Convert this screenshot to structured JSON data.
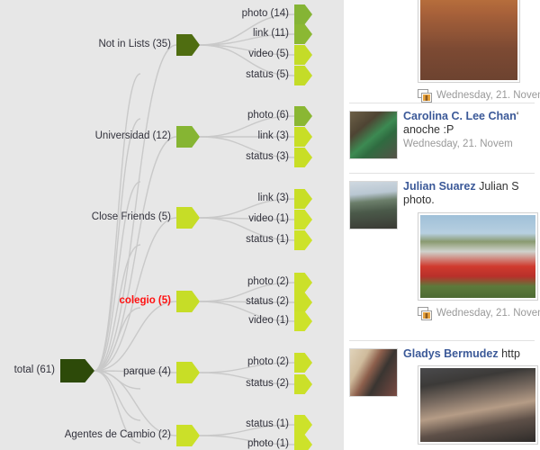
{
  "viz": {
    "background": "#e7e7e7",
    "link_color": "#c9c9c9",
    "root": {
      "label": "total (61)",
      "value": 61,
      "color": "#2d4a09"
    },
    "branches": [
      {
        "label": "Not in Lists (35)",
        "value": 35,
        "color": "#4f6d11",
        "children": [
          {
            "label": "photo (14)",
            "value": 14,
            "color": "#85b435"
          },
          {
            "label": "link (11)",
            "value": 11,
            "color": "#8bb833"
          },
          {
            "label": "video (5)",
            "value": 5,
            "color": "#c4dc28"
          },
          {
            "label": "status (5)",
            "value": 5,
            "color": "#c4dc28"
          }
        ]
      },
      {
        "label": "Universidad (12)",
        "value": 12,
        "color": "#86b533",
        "children": [
          {
            "label": "photo (6)",
            "value": 6,
            "color": "#8ab733"
          },
          {
            "label": "link (3)",
            "value": 3,
            "color": "#c8de26"
          },
          {
            "label": "status (3)",
            "value": 3,
            "color": "#c8de26"
          }
        ]
      },
      {
        "label": "Close Friends (5)",
        "value": 5,
        "color": "#c6dd27",
        "children": [
          {
            "label": "link (3)",
            "value": 3,
            "color": "#c8de26"
          },
          {
            "label": "video (1)",
            "value": 1,
            "color": "#cde22a"
          },
          {
            "label": "status (1)",
            "value": 1,
            "color": "#cde22a"
          }
        ]
      },
      {
        "label": "colegio (5)",
        "value": 5,
        "color": "#c6dd27",
        "highlight": true,
        "children": [
          {
            "label": "photo (2)",
            "value": 2,
            "color": "#cbe029"
          },
          {
            "label": "status (2)",
            "value": 2,
            "color": "#cbe029"
          },
          {
            "label": "video (1)",
            "value": 1,
            "color": "#cde22a"
          }
        ]
      },
      {
        "label": "parque (4)",
        "value": 4,
        "color": "#c8de26",
        "children": [
          {
            "label": "photo (2)",
            "value": 2,
            "color": "#cbe029"
          },
          {
            "label": "status (2)",
            "value": 2,
            "color": "#cbe029"
          }
        ]
      },
      {
        "label": "Agentes de Cambio (2)",
        "value": 2,
        "color": "#cbe029",
        "children": [
          {
            "label": "status (1)",
            "value": 1,
            "color": "#cde22a"
          },
          {
            "label": "photo (1)",
            "value": 1,
            "color": "#cde22a"
          }
        ]
      }
    ]
  },
  "feed": {
    "stories": [
      {
        "id": "story-top",
        "has_avatar": false,
        "big_photo": true,
        "photo_alt": "two-women-photo",
        "timestamp": "Wednesday, 21. Novem",
        "timestamp_icon": "photo-album-icon"
      },
      {
        "id": "story-carolina",
        "has_avatar": true,
        "avatar_alt": "woman-green-sweater-thumbnail",
        "name": "Carolina C. Lee Chan",
        "name_rest": "‘",
        "message": "anoche :P",
        "timestamp": "Wednesday, 21. Novem"
      },
      {
        "id": "story-julian",
        "has_avatar": true,
        "avatar_alt": "cyclists-mountain-thumbnail",
        "name": "Julian Suarez",
        "name_rest": "Julian S",
        "message": "photo.",
        "big_photo": true,
        "photo_alt": "cycling-team-red-banner-photo",
        "timestamp": "Wednesday, 21. Novem",
        "timestamp_icon": "photo-album-icon"
      },
      {
        "id": "story-gladys",
        "has_avatar": true,
        "avatar_alt": "couple-portrait-thumbnail",
        "name": "Gladys Bermudez",
        "name_rest": "http",
        "big_photo": true,
        "photo_alt": "woman-crowd-scene-photo"
      }
    ]
  }
}
